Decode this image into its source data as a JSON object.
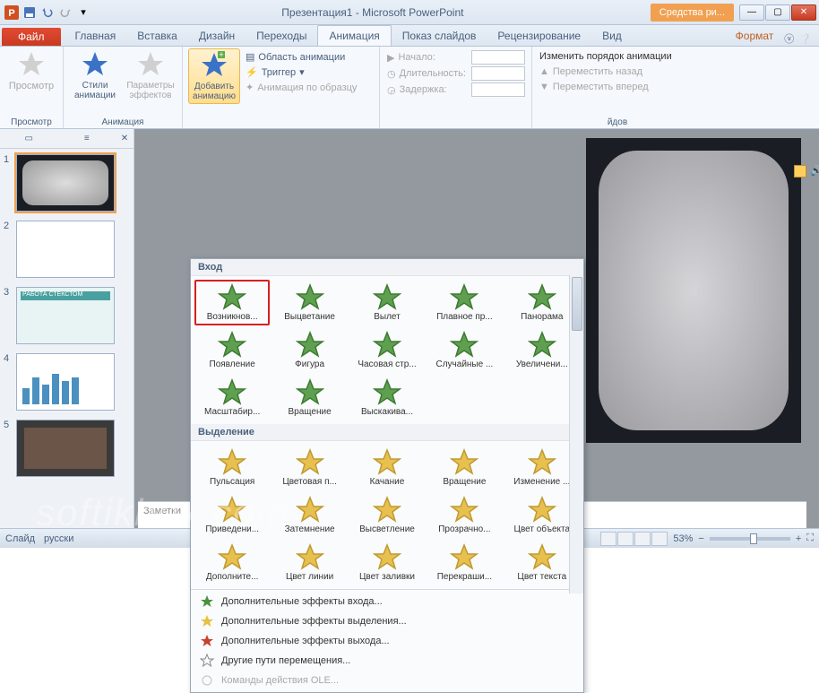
{
  "title": "Презентация1 - Microsoft PowerPoint",
  "context_tool": "Средства ри...",
  "tabs": {
    "file": "Файл",
    "items": [
      "Главная",
      "Вставка",
      "Дизайн",
      "Переходы",
      "Анимация",
      "Показ слайдов",
      "Рецензирование",
      "Вид"
    ],
    "context": "Формат",
    "active_index": 4
  },
  "ribbon": {
    "preview": {
      "btn": "Просмотр",
      "group": "Просмотр"
    },
    "animation": {
      "styles": "Стили анимации",
      "params": "Параметры эффектов",
      "group": "Анимация"
    },
    "add": {
      "btn": "Добавить анимацию",
      "pane": "Область анимации",
      "trigger": "Триггер",
      "painter": "Анимация по образцу"
    },
    "timing": {
      "start": "Начало:",
      "duration": "Длительность:",
      "delay": "Задержка:"
    },
    "reorder": {
      "header": "Изменить порядок анимации",
      "back": "Переместить назад",
      "fwd": "Переместить вперед"
    }
  },
  "gallery": {
    "sections": {
      "entrance": "Вход",
      "emphasis": "Выделение"
    },
    "entrance": [
      "Возникнов...",
      "Выцветание",
      "Вылет",
      "Плавное пр...",
      "Панорама",
      "Появление",
      "Фигура",
      "Часовая стр...",
      "Случайные ...",
      "Увеличени...",
      "Масштабир...",
      "Вращение",
      "Выскакива..."
    ],
    "emphasis": [
      "Пульсация",
      "Цветовая п...",
      "Качание",
      "Вращение",
      "Изменение ...",
      "Приведени...",
      "Затемнение",
      "Высветление",
      "Прозрачно...",
      "Цвет объекта",
      "Дополните...",
      "Цвет линии",
      "Цвет заливки",
      "Перекраши...",
      "Цвет текста"
    ],
    "more": {
      "entrance": "Дополнительные эффекты входа...",
      "emphasis": "Дополнительные эффекты выделения...",
      "exit": "Дополнительные эффекты выхода...",
      "motion": "Другие пути перемещения...",
      "ole": "Команды действия OLE..."
    }
  },
  "notes_placeholder": "Заметки",
  "status": {
    "slide": "Слайд",
    "lang": "русски",
    "zoom": "53%"
  },
  "thumbs": [
    1,
    2,
    3,
    4,
    5
  ],
  "watermark": "softikbox.com"
}
